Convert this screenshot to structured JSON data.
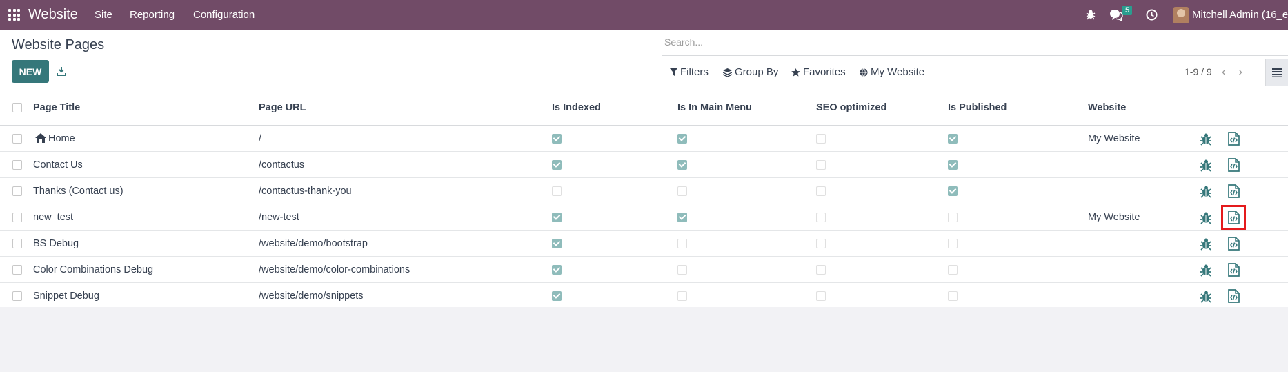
{
  "navbar": {
    "brand": "Website",
    "menus": [
      "Site",
      "Reporting",
      "Configuration"
    ],
    "message_count": "5",
    "user_name": "Mitchell Admin (16_e"
  },
  "control_panel": {
    "title": "Website Pages",
    "new_label": "NEW",
    "search_placeholder": "Search...",
    "filters": {
      "filters": "Filters",
      "group_by": "Group By",
      "favorites": "Favorites",
      "my_website": "My Website"
    },
    "pager": "1-9 / 9"
  },
  "table": {
    "headers": [
      "Page Title",
      "Page URL",
      "Is Indexed",
      "Is In Main Menu",
      "SEO optimized",
      "Is Published",
      "Website"
    ],
    "rows": [
      {
        "title": "Home",
        "url": "/",
        "indexed": true,
        "menu": true,
        "seo": false,
        "published": true,
        "website": "My Website",
        "home": true
      },
      {
        "title": "Contact Us",
        "url": "/contactus",
        "indexed": true,
        "menu": true,
        "seo": false,
        "published": true,
        "website": ""
      },
      {
        "title": "Thanks (Contact us)",
        "url": "/contactus-thank-you",
        "indexed": false,
        "menu": false,
        "seo": false,
        "published": true,
        "website": ""
      },
      {
        "title": "new_test",
        "url": "/new-test",
        "indexed": true,
        "menu": true,
        "seo": false,
        "published": false,
        "website": "My Website",
        "highlight": true
      },
      {
        "title": "BS Debug",
        "url": "/website/demo/bootstrap",
        "indexed": true,
        "menu": false,
        "seo": false,
        "published": false,
        "website": ""
      },
      {
        "title": "Color Combinations Debug",
        "url": "/website/demo/color-combinations",
        "indexed": true,
        "menu": false,
        "seo": false,
        "published": false,
        "website": ""
      },
      {
        "title": "Snippet Debug",
        "url": "/website/demo/snippets",
        "indexed": true,
        "menu": false,
        "seo": false,
        "published": false,
        "website": ""
      }
    ]
  },
  "colors": {
    "navbar": "#714b67",
    "primary": "#35777a",
    "checkbox": "#8fbcbb",
    "highlight": "#e41a1c"
  }
}
